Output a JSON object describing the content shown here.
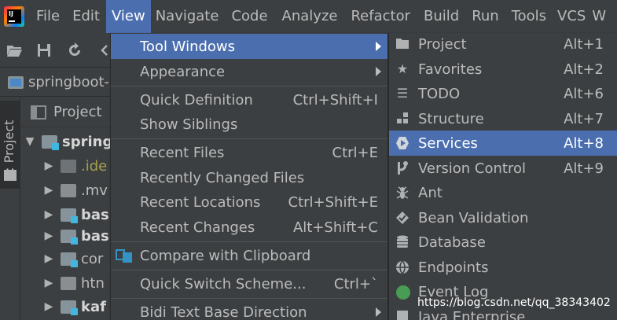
{
  "menubar": {
    "items": [
      {
        "label": "File"
      },
      {
        "label": "Edit"
      },
      {
        "label": "View"
      },
      {
        "label": "Navigate"
      },
      {
        "label": "Code"
      },
      {
        "label": "Analyze"
      },
      {
        "label": "Refactor"
      },
      {
        "label": "Build"
      },
      {
        "label": "Run"
      },
      {
        "label": "Tools"
      },
      {
        "label": "VCS"
      },
      {
        "label": "W"
      }
    ]
  },
  "navbar": {
    "label": "springboot-"
  },
  "side_strip": {
    "tab_label": "1: Project"
  },
  "project_panel": {
    "title": "Project",
    "tree": [
      {
        "label": "spring"
      },
      {
        "label": ".ide"
      },
      {
        "label": ".mv"
      },
      {
        "label": "bas"
      },
      {
        "label": "bas"
      },
      {
        "label": "cor"
      },
      {
        "label": "htn"
      },
      {
        "label": "kaf"
      }
    ]
  },
  "view_menu": {
    "items": [
      {
        "label": "Tool Windows",
        "shortcut": ""
      },
      {
        "label": "Appearance",
        "shortcut": ""
      },
      {
        "label": "Quick Definition",
        "shortcut": "Ctrl+Shift+I"
      },
      {
        "label": "Show Siblings",
        "shortcut": ""
      },
      {
        "label": "Recent Files",
        "shortcut": "Ctrl+E"
      },
      {
        "label": "Recently Changed Files",
        "shortcut": ""
      },
      {
        "label": "Recent Locations",
        "shortcut": "Ctrl+Shift+E"
      },
      {
        "label": "Recent Changes",
        "shortcut": "Alt+Shift+C"
      },
      {
        "label": "Compare with Clipboard",
        "shortcut": ""
      },
      {
        "label": "Quick Switch Scheme...",
        "shortcut": "Ctrl+`"
      },
      {
        "label": "Bidi Text Base Direction",
        "shortcut": ""
      }
    ]
  },
  "tool_windows_menu": {
    "items": [
      {
        "label": "Project",
        "shortcut": "Alt+1",
        "icon": "folder-icon"
      },
      {
        "label": "Favorites",
        "shortcut": "Alt+2",
        "icon": "star-icon"
      },
      {
        "label": "TODO",
        "shortcut": "Alt+6",
        "icon": "list-icon"
      },
      {
        "label": "Structure",
        "shortcut": "Alt+7",
        "icon": "structure-icon"
      },
      {
        "label": "Services",
        "shortcut": "Alt+8",
        "icon": "services-icon"
      },
      {
        "label": "Version Control",
        "shortcut": "Alt+9",
        "icon": "vcs-icon"
      },
      {
        "label": "Ant",
        "shortcut": "",
        "icon": "ant-icon"
      },
      {
        "label": "Bean Validation",
        "shortcut": "",
        "icon": "bean-icon"
      },
      {
        "label": "Database",
        "shortcut": "",
        "icon": "database-icon"
      },
      {
        "label": "Endpoints",
        "shortcut": "",
        "icon": "globe-icon"
      },
      {
        "label": "Event Log",
        "shortcut": "",
        "icon": "event-log-icon"
      },
      {
        "label": "Java Enterprise",
        "shortcut": "",
        "icon": "java-ee-icon"
      }
    ]
  },
  "watermark": "https://blog.csdn.net/qq_38343402",
  "colors": {
    "background": "#3c3f41",
    "selection": "#4b6eaf",
    "text": "#bbbbbb"
  }
}
